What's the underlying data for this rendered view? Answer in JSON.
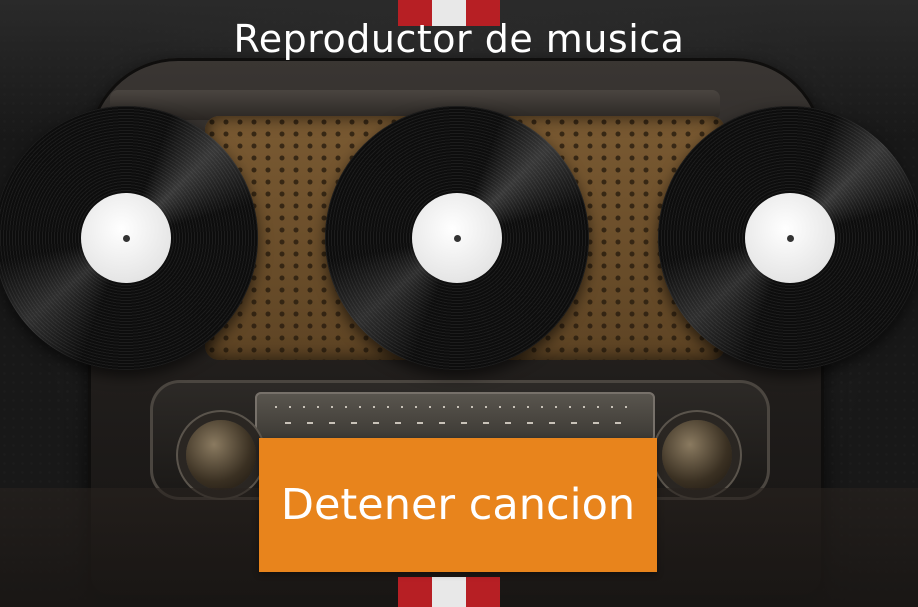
{
  "header": {
    "title": "Reproductor de musica"
  },
  "records": [
    {
      "icon": "vinyl-record-icon"
    },
    {
      "icon": "vinyl-record-icon"
    },
    {
      "icon": "vinyl-record-icon"
    }
  ],
  "controls": {
    "stop_label": "Detener cancion"
  },
  "colors": {
    "button": "#e8841c",
    "stripe_red": "#b71f24",
    "stripe_white": "#e8e8e8"
  }
}
